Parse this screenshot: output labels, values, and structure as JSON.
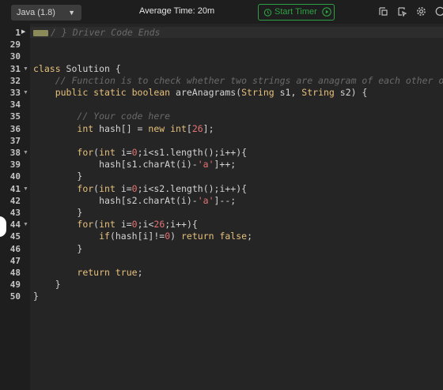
{
  "toolbar": {
    "language": "Java (1.8)",
    "avg_time": "Average Time: 20m",
    "start_timer": "Start Timer"
  },
  "editor": {
    "line_numbers": [
      "1",
      "29",
      "30",
      "31",
      "32",
      "33",
      "34",
      "35",
      "36",
      "37",
      "38",
      "39",
      "40",
      "41",
      "42",
      "43",
      "44",
      "45",
      "46",
      "47",
      "48",
      "49",
      "50"
    ],
    "lines": [
      [
        {
          "t": "comment",
          "v": "/ } Driver Code Ends"
        }
      ],
      [],
      [],
      [
        {
          "t": "kw",
          "v": "class "
        },
        {
          "t": "plain",
          "v": "Solution {"
        }
      ],
      [
        {
          "t": "plain",
          "v": "    "
        },
        {
          "t": "comment",
          "v": "// Function is to check whether two strings are anagram of each other o"
        }
      ],
      [
        {
          "t": "plain",
          "v": "    "
        },
        {
          "t": "kw",
          "v": "public static boolean "
        },
        {
          "t": "plain",
          "v": "areAnagrams("
        },
        {
          "t": "kw",
          "v": "String "
        },
        {
          "t": "plain",
          "v": "s1, "
        },
        {
          "t": "kw",
          "v": "String "
        },
        {
          "t": "plain",
          "v": "s2) {"
        }
      ],
      [],
      [
        {
          "t": "plain",
          "v": "        "
        },
        {
          "t": "comment",
          "v": "// Your code here"
        }
      ],
      [
        {
          "t": "plain",
          "v": "        "
        },
        {
          "t": "kw",
          "v": "int "
        },
        {
          "t": "plain",
          "v": "hash[] = "
        },
        {
          "t": "kw",
          "v": "new int"
        },
        {
          "t": "plain",
          "v": "["
        },
        {
          "t": "num",
          "v": "26"
        },
        {
          "t": "plain",
          "v": "];"
        }
      ],
      [],
      [
        {
          "t": "plain",
          "v": "        "
        },
        {
          "t": "kw",
          "v": "for"
        },
        {
          "t": "plain",
          "v": "("
        },
        {
          "t": "kw",
          "v": "int "
        },
        {
          "t": "plain",
          "v": "i="
        },
        {
          "t": "num",
          "v": "0"
        },
        {
          "t": "plain",
          "v": ";i<s1.length();i++){"
        }
      ],
      [
        {
          "t": "plain",
          "v": "            hash[s1.charAt(i)-"
        },
        {
          "t": "str",
          "v": "'a'"
        },
        {
          "t": "plain",
          "v": "]++;"
        }
      ],
      [
        {
          "t": "plain",
          "v": "        }"
        }
      ],
      [
        {
          "t": "plain",
          "v": "        "
        },
        {
          "t": "kw",
          "v": "for"
        },
        {
          "t": "plain",
          "v": "("
        },
        {
          "t": "kw",
          "v": "int "
        },
        {
          "t": "plain",
          "v": "i="
        },
        {
          "t": "num",
          "v": "0"
        },
        {
          "t": "plain",
          "v": ";i<s2.length();i++){"
        }
      ],
      [
        {
          "t": "plain",
          "v": "            hash[s2.charAt(i)-"
        },
        {
          "t": "str",
          "v": "'a'"
        },
        {
          "t": "plain",
          "v": "]--;"
        }
      ],
      [
        {
          "t": "plain",
          "v": "        }"
        }
      ],
      [
        {
          "t": "plain",
          "v": "        "
        },
        {
          "t": "kw",
          "v": "for"
        },
        {
          "t": "plain",
          "v": "("
        },
        {
          "t": "kw",
          "v": "int "
        },
        {
          "t": "plain",
          "v": "i="
        },
        {
          "t": "num",
          "v": "0"
        },
        {
          "t": "plain",
          "v": ";i<"
        },
        {
          "t": "num",
          "v": "26"
        },
        {
          "t": "plain",
          "v": ";i++){"
        }
      ],
      [
        {
          "t": "plain",
          "v": "            "
        },
        {
          "t": "kw",
          "v": "if"
        },
        {
          "t": "plain",
          "v": "(hash[i]!="
        },
        {
          "t": "num",
          "v": "0"
        },
        {
          "t": "plain",
          "v": ") "
        },
        {
          "t": "kw",
          "v": "return false"
        },
        {
          "t": "plain",
          "v": ";"
        }
      ],
      [
        {
          "t": "plain",
          "v": "        }"
        }
      ],
      [],
      [
        {
          "t": "plain",
          "v": "        "
        },
        {
          "t": "kw",
          "v": "return true"
        },
        {
          "t": "plain",
          "v": ";"
        }
      ],
      [
        {
          "t": "plain",
          "v": "    }"
        }
      ],
      [
        {
          "t": "plain",
          "v": "}"
        }
      ]
    ],
    "folded_lines": [
      "31",
      "33",
      "38",
      "41",
      "44"
    ]
  },
  "colors": {
    "accent_green": "#2ea043",
    "keyword": "#e6c07b",
    "comment": "#6a6a6a",
    "number": "#e57373"
  }
}
